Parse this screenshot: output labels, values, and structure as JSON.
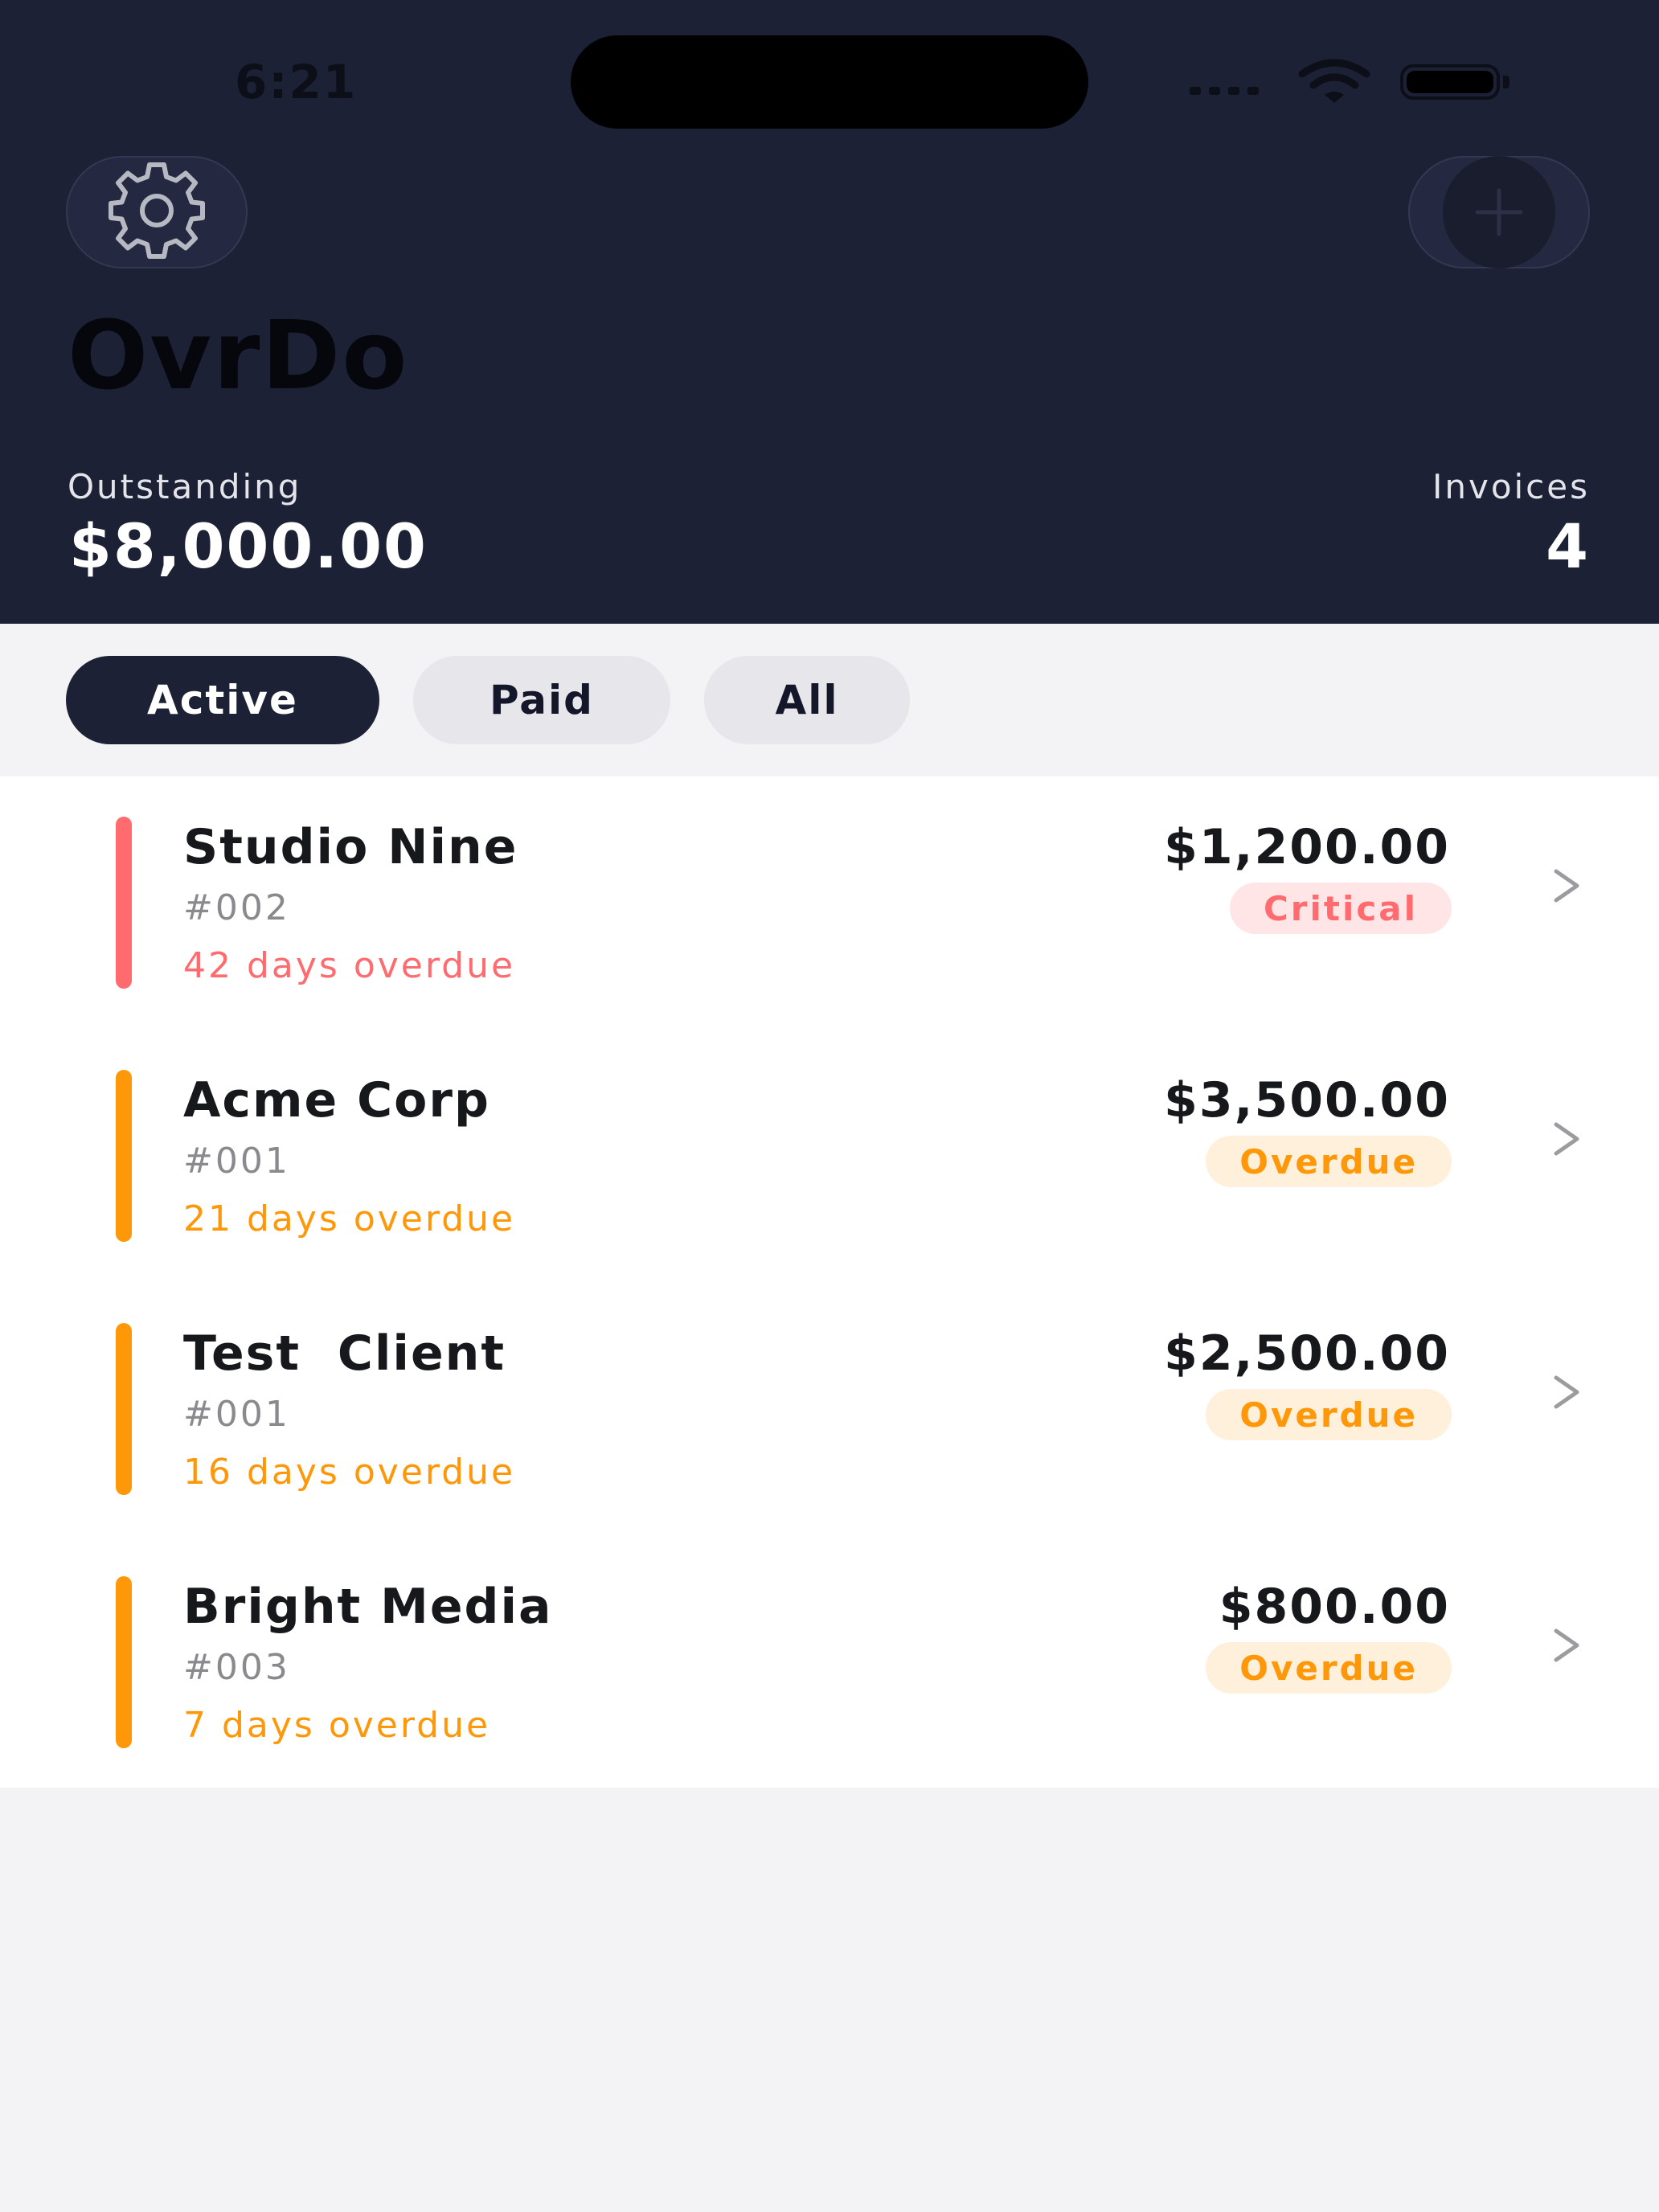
{
  "status_bar": {
    "time": "6:21"
  },
  "header": {
    "settings_icon": "gear-icon",
    "add_icon": "plus-icon",
    "title": "OvrDo",
    "outstanding_label": "Outstanding",
    "outstanding_value": "$8,000.00",
    "invoices_label": "Invoices",
    "invoices_value": "4"
  },
  "tabs": [
    {
      "label": "Active",
      "selected": true
    },
    {
      "label": "Paid",
      "selected": false
    },
    {
      "label": "All",
      "selected": false
    }
  ],
  "invoices": [
    {
      "client": "Studio Nine",
      "number": "#002",
      "overdue_text": "42 days overdue",
      "amount": "$1,200.00",
      "status": "Critical",
      "color": "#ff6b6f",
      "badge_bg": "#ffe5e6"
    },
    {
      "client": "Acme Corp",
      "number": "#001",
      "overdue_text": "21 days overdue",
      "amount": "$3,500.00",
      "status": "Overdue",
      "color": "#ff9808",
      "badge_bg": "#fff0dc"
    },
    {
      "client": "Test  Client",
      "number": "#001",
      "overdue_text": "16 days overdue",
      "amount": "$2,500.00",
      "status": "Overdue",
      "color": "#ff9808",
      "badge_bg": "#fff0dc"
    },
    {
      "client": "Bright Media",
      "number": "#003",
      "overdue_text": "7 days overdue",
      "amount": "$800.00",
      "status": "Overdue",
      "color": "#ff9808",
      "badge_bg": "#fff0dc"
    }
  ],
  "colors": {
    "header_bg": "#1d2136",
    "critical": "#ff6b6f",
    "overdue": "#ff9808"
  }
}
